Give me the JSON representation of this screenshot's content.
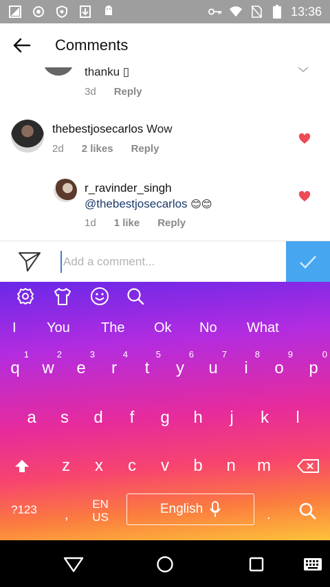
{
  "status_bar": {
    "time": "13:36",
    "left_icons": [
      "screenshot-icon",
      "record-icon",
      "shield-icon",
      "download-icon",
      "android-icon"
    ],
    "right_icons": [
      "key-icon",
      "wifi-icon",
      "no-sim-icon",
      "battery-icon"
    ]
  },
  "header": {
    "title": "Comments",
    "back_icon": "arrow-left-icon"
  },
  "comments": [
    {
      "text": "thanku ▯",
      "time": "3d",
      "reply_label": "Reply"
    },
    {
      "username": "thebestjosecarlos",
      "text": "Wow",
      "time": "2d",
      "likes": "2 likes",
      "reply_label": "Reply",
      "liked": true
    },
    {
      "username": "r_ravinder_singh",
      "mention": "@thebestjosecarlos",
      "emoji": "😊😊",
      "time": "1d",
      "likes": "1 like",
      "reply_label": "Reply",
      "liked": true
    }
  ],
  "compose": {
    "placeholder": "Add a comment...",
    "value": ""
  },
  "keyboard": {
    "toolbar_icons": [
      "settings-icon",
      "theme-shirt-icon",
      "emoji-icon",
      "search-icon"
    ],
    "suggestions": [
      "I",
      "You",
      "The",
      "Ok",
      "No",
      "What"
    ],
    "row1": [
      {
        "key": "q",
        "num": "1"
      },
      {
        "key": "w",
        "num": "2"
      },
      {
        "key": "e",
        "num": "3"
      },
      {
        "key": "r",
        "num": "4"
      },
      {
        "key": "t",
        "num": "5"
      },
      {
        "key": "y",
        "num": "6"
      },
      {
        "key": "u",
        "num": "7"
      },
      {
        "key": "i",
        "num": "8"
      },
      {
        "key": "o",
        "num": "9"
      },
      {
        "key": "p",
        "num": "0"
      }
    ],
    "row2": [
      "a",
      "s",
      "d",
      "f",
      "g",
      "h",
      "j",
      "k",
      "l"
    ],
    "row3": [
      "z",
      "x",
      "c",
      "v",
      "b",
      "n",
      "m"
    ],
    "symbols_label": "?123",
    "comma_label": ",",
    "lang_switch_line1": "EN",
    "lang_switch_line2": "US",
    "space_label": "English",
    "period_label": ".",
    "colors": {
      "gradient_top": "#6a28e8",
      "gradient_mid": "#e62b9c",
      "gradient_bottom": "#fdc23a"
    }
  },
  "colors": {
    "heart": "#ed4956",
    "post_button": "#47a6f0",
    "mention": "#1a3a6b",
    "status_bar": "#9e9e9e"
  }
}
